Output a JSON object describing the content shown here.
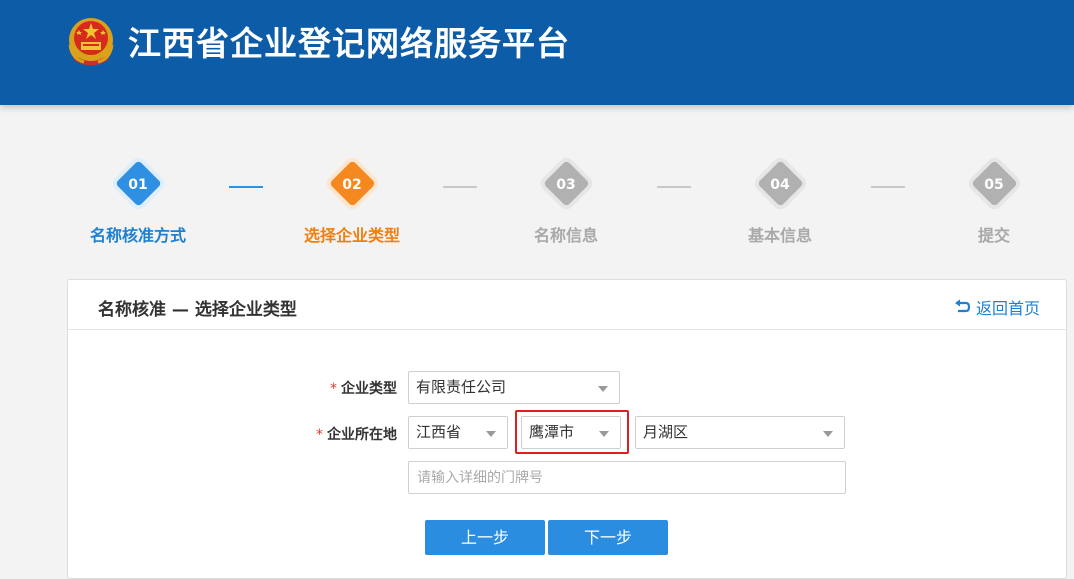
{
  "header": {
    "title": "江西省企业登记网络服务平台",
    "emblem_icon": "national-emblem-icon",
    "background_color": "#0d5ca8"
  },
  "stepper": {
    "current_step": 2,
    "steps": [
      {
        "num": "01",
        "label": "名称核准方式",
        "state": "done"
      },
      {
        "num": "02",
        "label": "选择企业类型",
        "state": "active"
      },
      {
        "num": "03",
        "label": "名称信息",
        "state": "todo"
      },
      {
        "num": "04",
        "label": "基本信息",
        "state": "todo"
      },
      {
        "num": "05",
        "label": "提交",
        "state": "todo"
      }
    ],
    "colors": {
      "done": "#2f8fe0",
      "active": "#f5891f",
      "todo": "#b1b1b1"
    }
  },
  "panel": {
    "title": "名称核准 — 选择企业类型",
    "back_link": "返回首页",
    "back_icon": "return-arrow-icon"
  },
  "form": {
    "required_mark": "*",
    "enterprise_type": {
      "label": "企业类型",
      "value": "有限责任公司"
    },
    "location": {
      "label": "企业所在地",
      "province": "江西省",
      "city": "鹰潭市",
      "district": "月湖区"
    },
    "address": {
      "placeholder": "请输入详细的门牌号",
      "value": ""
    },
    "highlight_color": "#e02020"
  },
  "buttons": {
    "prev": "上一步",
    "next": "下一步",
    "color": "#2b8ddf"
  }
}
